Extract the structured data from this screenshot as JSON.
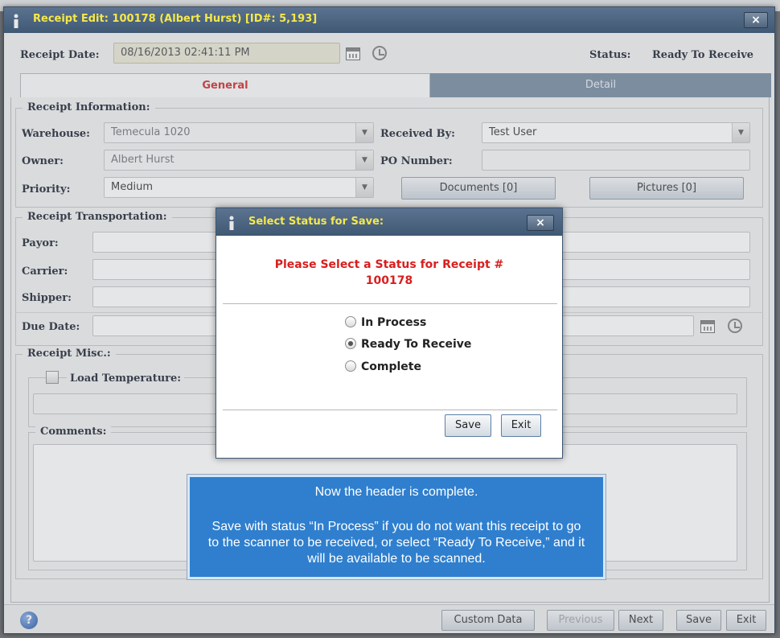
{
  "window": {
    "title": "Receipt Edit:  100178 (Albert Hurst) [ID#: 5,193]",
    "close": "×"
  },
  "header": {
    "receipt_date_label": "Receipt Date:",
    "receipt_date_value": "08/16/2013 02:41:11 PM",
    "status_label": "Status:",
    "status_value": "Ready To Receive"
  },
  "tabs": [
    {
      "label": "General",
      "active": true
    },
    {
      "label": "Detail",
      "active": false
    }
  ],
  "receipt_info": {
    "title": "Receipt Information:",
    "warehouse_label": "Warehouse:",
    "warehouse_value": "Temecula 1020",
    "owner_label": "Owner:",
    "owner_value": "Albert Hurst",
    "priority_label": "Priority:",
    "priority_value": "Medium",
    "received_by_label": "Received By:",
    "received_by_value": "Test User",
    "po_label": "PO Number:",
    "po_value": "",
    "documents_button": "Documents [0]",
    "pictures_button": "Pictures [0]"
  },
  "transport": {
    "title": "Receipt Transportation:",
    "payor_label": "Payor:",
    "carrier_label": "Carrier:",
    "shipper_label": "Shipper:",
    "due_date_label": "Due Date:"
  },
  "misc": {
    "title": "Receipt Misc.:",
    "load_temp_label": "Load Temperature:",
    "comments_label": "Comments:"
  },
  "bottom": {
    "help": "?",
    "custom_data": "Custom Data",
    "previous": "Previous",
    "next": "Next",
    "save": "Save",
    "exit": "Exit"
  },
  "modal": {
    "title": "Select Status for Save:",
    "close": "×",
    "message_line1": "Please Select a Status for Receipt #",
    "message_line2": "100178",
    "options": [
      {
        "label": "In Process",
        "selected": false
      },
      {
        "label": "Ready To Receive",
        "selected": true
      },
      {
        "label": "Complete",
        "selected": false
      }
    ],
    "save": "Save",
    "exit": "Exit"
  },
  "callout": {
    "line1": "Now the header is complete.",
    "line2": "Save with status “In Process” if you do not want this receipt to go to the scanner to be received, or select “Ready To Receive,” and it will be available to be scanned."
  },
  "colors": {
    "title_bar": "#4d6581",
    "title_text": "#f5e84a",
    "active_tab_text": "#d23a3a",
    "modal_message": "#d91e1e",
    "callout_bg": "#2f7fce"
  },
  "icons": [
    "app-logo-icon",
    "calendar-icon",
    "clock-icon",
    "dropdown-arrow-icon",
    "help-icon",
    "close-icon"
  ]
}
